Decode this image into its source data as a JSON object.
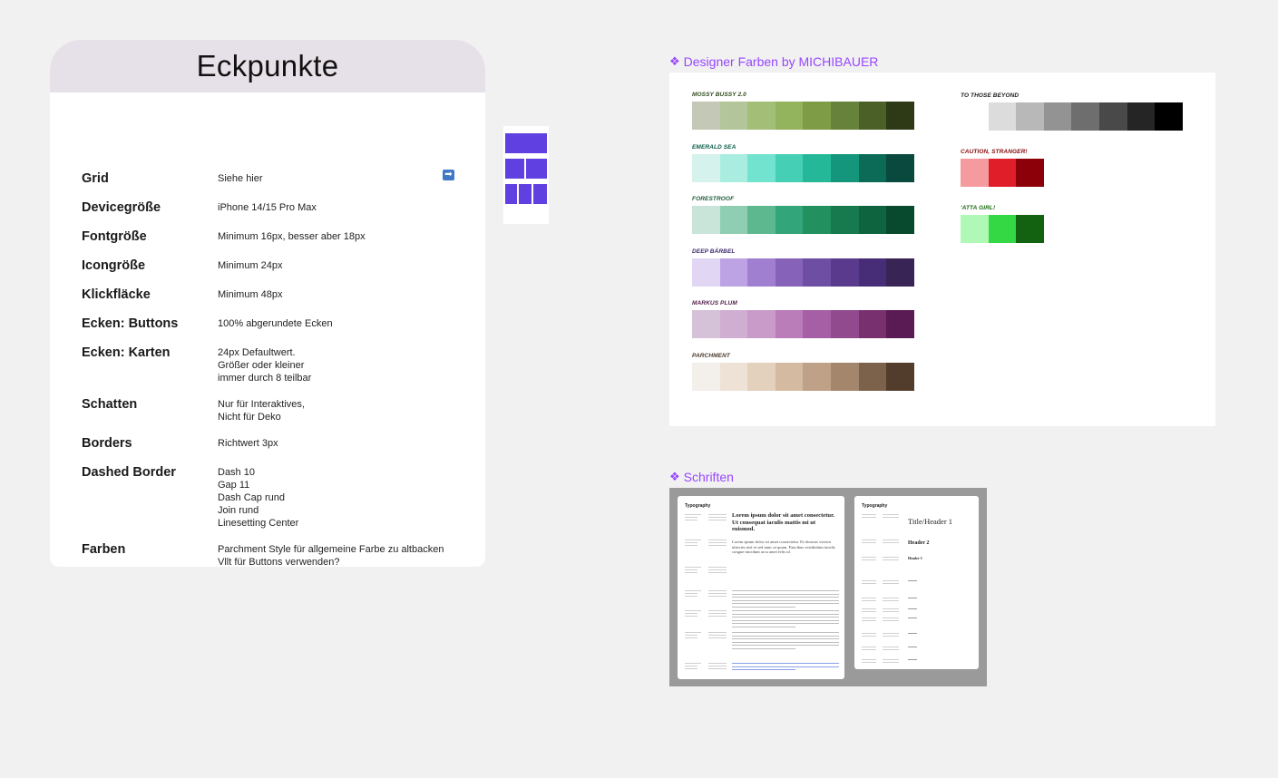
{
  "card": {
    "title": "Eckpunkte",
    "rows": [
      {
        "label": "Grid",
        "lines": [
          "Siehe hier"
        ],
        "icon": "arrow-right-icon"
      },
      {
        "label": "Devicegröße",
        "lines": [
          "iPhone 14/15 Pro Max"
        ]
      },
      {
        "label": "Fontgröße",
        "lines": [
          "Minimum 16px, besser aber 18px"
        ]
      },
      {
        "label": "Icongröße",
        "lines": [
          "Minimum 24px"
        ]
      },
      {
        "label": "Klickfläcke",
        "lines": [
          "Minimum 48px"
        ]
      },
      {
        "label": "Ecken: Buttons",
        "lines": [
          "100% abgerundete Ecken"
        ]
      },
      {
        "label": "Ecken: Karten",
        "lines": [
          "24px Defaultwert.",
          "Größer oder kleiner",
          "immer durch 8 teilbar"
        ]
      },
      {
        "label": "Schatten",
        "lines": [
          "Nur für Interaktives,",
          "Nicht für Deko"
        ]
      },
      {
        "label": "Borders",
        "lines": [
          "Richtwert 3px"
        ]
      },
      {
        "label": "Dashed Border",
        "lines": [
          "Dash 10",
          "Gap 11",
          "Dash Cap rund",
          "Join rund",
          "Linesetting Center"
        ]
      },
      {
        "label": "Farben",
        "lines": [
          "Parchment Style für allgemeine Farbe zu altbacken",
          "Vllt für Buttons verwenden?"
        ]
      }
    ]
  },
  "sections": {
    "colors_title": "Designer Farben by MICHIBAUER",
    "fonts_title": "Schriften",
    "icon": "diamond-component-icon",
    "accent": "#9747ff"
  },
  "palettes_left": [
    {
      "name": "Mossy Bussy 2.0",
      "name_color": "#2f4a1a",
      "colors": [
        "#c4c8b6",
        "#b3c69a",
        "#a3be77",
        "#93b35c",
        "#7e9c45",
        "#67823a",
        "#4b6027",
        "#2e3915"
      ]
    },
    {
      "name": "Emerald Sea",
      "name_color": "#0b5c48",
      "colors": [
        "#d6f2ec",
        "#a8ede0",
        "#71e3cf",
        "#45d0b6",
        "#25b898",
        "#13967c",
        "#0b6b57",
        "#0a4a3e"
      ]
    },
    {
      "name": "Forestroof",
      "name_color": "#1d5a3b",
      "colors": [
        "#c9e4d9",
        "#8fceb3",
        "#5db890",
        "#33a57a",
        "#23905f",
        "#167a4e",
        "#0f6440",
        "#084a2e"
      ]
    },
    {
      "name": "Deep Bärbel",
      "name_color": "#3e2a6e",
      "colors": [
        "#e2d6f5",
        "#bda3e3",
        "#a07fd0",
        "#8663b8",
        "#6e4ea3",
        "#5a3a8d",
        "#472d77",
        "#382455"
      ]
    },
    {
      "name": "Markus Plum",
      "name_color": "#53214d",
      "colors": [
        "#d5c2d8",
        "#d0aed2",
        "#c99bc9",
        "#bb7cba",
        "#a65ea4",
        "#924a8e",
        "#78306f",
        "#5a1a53"
      ]
    },
    {
      "name": "Parchment",
      "name_color": "#4a3a2e",
      "colors": [
        "#f3efeb",
        "#eee2d6",
        "#e3d0bd",
        "#d4baa1",
        "#bea186",
        "#a3866c",
        "#7c614b",
        "#523d2d"
      ]
    }
  ],
  "palettes_right": [
    {
      "name": "To those beyond",
      "name_color": "#1a1a1a",
      "colors": [
        "#ffffff",
        "#dcdcdc",
        "#b8b8b8",
        "#939393",
        "#6e6e6e",
        "#494949",
        "#252525",
        "#000000"
      ]
    },
    {
      "name": "Caution, Stranger!",
      "name_color": "#8a0a0a",
      "colors": [
        "#f59a9e",
        "#e01e2a",
        "#8c0009"
      ]
    },
    {
      "name": "'Atta Girl!",
      "name_color": "#1f6b12",
      "colors": [
        "#aff8b6",
        "#34d844",
        "#126212"
      ]
    }
  ],
  "typography": {
    "card_title": "Typography",
    "sample_heading": "Lorem ipsum dolor sit amet consectetur. Ut consequat iaculis mattis mi ut euismod.",
    "sample_sub": "Lorem ipsum dolor sit amet consectetur. Et rhoncus viverra ultricies nisl et sed nunc at quam. Faucibus vestibulum iaculis congue tincidunt arcu amet felis id.",
    "title_header_1": "Title/Header 1",
    "header_2": "Header 2",
    "header_3": "Header 3"
  }
}
